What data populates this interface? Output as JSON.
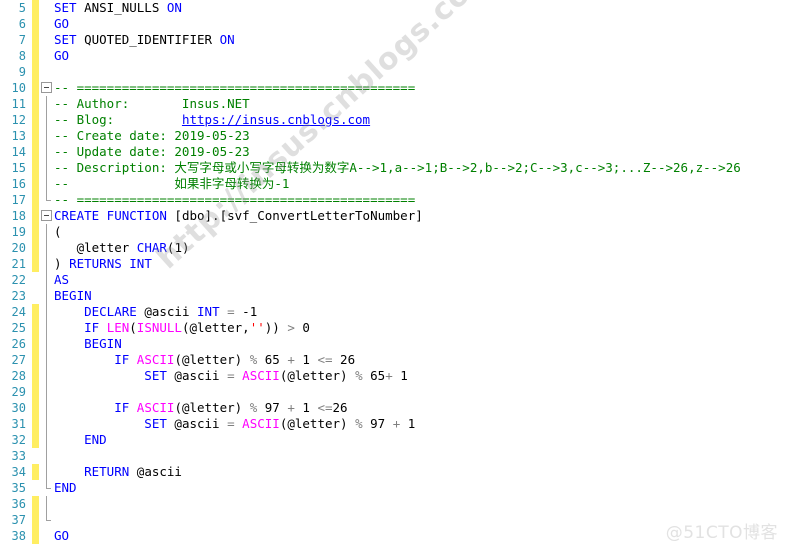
{
  "editor": {
    "language": "sql",
    "theme": "ssms-light",
    "first_visible_line": 5,
    "last_visible_line": 38,
    "colors": {
      "keyword": "#0000ff",
      "function": "#ff00ff",
      "comment": "#008000",
      "string": "#ff0000",
      "operator": "#808080",
      "line_number": "#2b91af",
      "change_bar_modified": "#ffee62",
      "background": "#ffffff"
    }
  },
  "watermarks": {
    "diagonal": "http://insus.cnblogs.com",
    "corner": "@51CTO博客"
  },
  "lines": [
    {
      "n": 5,
      "changed": true,
      "fold": "none",
      "text": "SET ANSI_NULLS ON"
    },
    {
      "n": 6,
      "changed": true,
      "fold": "none",
      "text": "GO"
    },
    {
      "n": 7,
      "changed": true,
      "fold": "none",
      "text": "SET QUOTED_IDENTIFIER ON"
    },
    {
      "n": 8,
      "changed": true,
      "fold": "none",
      "text": "GO"
    },
    {
      "n": 9,
      "changed": true,
      "fold": "none",
      "text": ""
    },
    {
      "n": 10,
      "changed": true,
      "fold": "box",
      "text": "-- ============================================="
    },
    {
      "n": 11,
      "changed": true,
      "fold": "line",
      "text": "-- Author:       Insus.NET"
    },
    {
      "n": 12,
      "changed": true,
      "fold": "line",
      "text": "-- Blog:         https://insus.cnblogs.com"
    },
    {
      "n": 13,
      "changed": true,
      "fold": "line",
      "text": "-- Create date: 2019-05-23"
    },
    {
      "n": 14,
      "changed": true,
      "fold": "line",
      "text": "-- Update date: 2019-05-23"
    },
    {
      "n": 15,
      "changed": true,
      "fold": "line",
      "text": "-- Description: 大写字母或小写字母转换为数字A-->1,a-->1;B-->2,b-->2;C-->3,c-->3;...Z-->26,z-->26"
    },
    {
      "n": 16,
      "changed": true,
      "fold": "line",
      "text": "--              如果非字母转换为-1"
    },
    {
      "n": 17,
      "changed": true,
      "fold": "lineend",
      "text": "-- ============================================="
    },
    {
      "n": 18,
      "changed": true,
      "fold": "box",
      "text": "CREATE FUNCTION [dbo].[svf_ConvertLetterToNumber]"
    },
    {
      "n": 19,
      "changed": true,
      "fold": "line",
      "text": "("
    },
    {
      "n": 20,
      "changed": true,
      "fold": "line",
      "text": "   @letter CHAR(1)"
    },
    {
      "n": 21,
      "changed": true,
      "fold": "line",
      "text": ") RETURNS INT"
    },
    {
      "n": 22,
      "changed": false,
      "fold": "line",
      "text": "AS"
    },
    {
      "n": 23,
      "changed": false,
      "fold": "line",
      "text": "BEGIN"
    },
    {
      "n": 24,
      "changed": true,
      "fold": "line",
      "text": "    DECLARE @ascii INT = -1"
    },
    {
      "n": 25,
      "changed": true,
      "fold": "line",
      "text": "    IF LEN(ISNULL(@letter,'')) > 0"
    },
    {
      "n": 26,
      "changed": true,
      "fold": "line",
      "text": "    BEGIN"
    },
    {
      "n": 27,
      "changed": true,
      "fold": "line",
      "text": "        IF ASCII(@letter) % 65 + 1 <= 26"
    },
    {
      "n": 28,
      "changed": true,
      "fold": "line",
      "text": "            SET @ascii = ASCII(@letter) % 65+ 1"
    },
    {
      "n": 29,
      "changed": true,
      "fold": "line",
      "text": ""
    },
    {
      "n": 30,
      "changed": true,
      "fold": "line",
      "text": "        IF ASCII(@letter) % 97 + 1 <=26"
    },
    {
      "n": 31,
      "changed": true,
      "fold": "line",
      "text": "            SET @ascii = ASCII(@letter) % 97 + 1"
    },
    {
      "n": 32,
      "changed": true,
      "fold": "line",
      "text": "    END"
    },
    {
      "n": 33,
      "changed": false,
      "fold": "line",
      "text": ""
    },
    {
      "n": 34,
      "changed": true,
      "fold": "line",
      "text": "    RETURN @ascii"
    },
    {
      "n": 35,
      "changed": false,
      "fold": "lineend",
      "text": "END"
    },
    {
      "n": 36,
      "changed": true,
      "fold": "line2",
      "text": ""
    },
    {
      "n": 37,
      "changed": true,
      "fold": "line2end",
      "text": ""
    },
    {
      "n": 38,
      "changed": true,
      "fold": "none",
      "text": "GO"
    }
  ],
  "tokens": {
    "line5": [
      [
        "kw",
        "SET"
      ],
      [
        "id",
        " ANSI_NULLS "
      ],
      [
        "kw",
        "ON"
      ]
    ],
    "line6": [
      [
        "kw",
        "GO"
      ]
    ],
    "line7": [
      [
        "kw",
        "SET"
      ],
      [
        "id",
        " QUOTED_IDENTIFIER "
      ],
      [
        "kw",
        "ON"
      ]
    ],
    "line8": [
      [
        "kw",
        "GO"
      ]
    ],
    "line18": [
      [
        "kw",
        "CREATE FUNCTION"
      ],
      [
        "id",
        " [dbo].[svf_ConvertLetterToNumber]"
      ]
    ],
    "line20": [
      [
        "id",
        "   @letter "
      ],
      [
        "kw",
        "CHAR"
      ],
      [
        "id",
        "("
      ],
      [
        "num",
        "1"
      ],
      [
        "id",
        ")"
      ]
    ],
    "line21": [
      [
        "id",
        ") "
      ],
      [
        "kw",
        "RETURNS INT"
      ]
    ],
    "line22": [
      [
        "kw",
        "AS"
      ]
    ],
    "line23": [
      [
        "kw",
        "BEGIN"
      ]
    ],
    "line24": [
      [
        "kw",
        "    DECLARE"
      ],
      [
        "id",
        " @ascii "
      ],
      [
        "kw",
        "INT"
      ],
      [
        "op",
        " = "
      ],
      [
        "num",
        "-1"
      ]
    ],
    "line25": [
      [
        "kw",
        "    IF "
      ],
      [
        "fn",
        "LEN"
      ],
      [
        "id",
        "("
      ],
      [
        "fn",
        "ISNULL"
      ],
      [
        "id",
        "(@letter,"
      ],
      [
        "str",
        "''"
      ],
      [
        "id",
        "))"
      ],
      [
        "op",
        " > "
      ],
      [
        "num",
        "0"
      ]
    ],
    "line26": [
      [
        "kw",
        "    BEGIN"
      ]
    ],
    "line27": [
      [
        "kw",
        "        IF "
      ],
      [
        "fn",
        "ASCII"
      ],
      [
        "id",
        "(@letter) "
      ],
      [
        "op",
        "% "
      ],
      [
        "num",
        "65"
      ],
      [
        "op",
        " + "
      ],
      [
        "num",
        "1"
      ],
      [
        "op",
        " <= "
      ],
      [
        "num",
        "26"
      ]
    ],
    "line28": [
      [
        "kw",
        "            SET"
      ],
      [
        "id",
        " @ascii "
      ],
      [
        "op",
        "= "
      ],
      [
        "fn",
        "ASCII"
      ],
      [
        "id",
        "(@letter) "
      ],
      [
        "op",
        "% "
      ],
      [
        "num",
        "65"
      ],
      [
        "op",
        "+ "
      ],
      [
        "num",
        "1"
      ]
    ],
    "line30": [
      [
        "kw",
        "        IF "
      ],
      [
        "fn",
        "ASCII"
      ],
      [
        "id",
        "(@letter) "
      ],
      [
        "op",
        "% "
      ],
      [
        "num",
        "97"
      ],
      [
        "op",
        " + "
      ],
      [
        "num",
        "1"
      ],
      [
        "op",
        " <="
      ],
      [
        "num",
        "26"
      ]
    ],
    "line31": [
      [
        "kw",
        "            SET"
      ],
      [
        "id",
        " @ascii "
      ],
      [
        "op",
        "= "
      ],
      [
        "fn",
        "ASCII"
      ],
      [
        "id",
        "(@letter) "
      ],
      [
        "op",
        "% "
      ],
      [
        "num",
        "97"
      ],
      [
        "op",
        " + "
      ],
      [
        "num",
        "1"
      ]
    ],
    "line32": [
      [
        "kw",
        "    END"
      ]
    ],
    "line34": [
      [
        "kw",
        "    RETURN"
      ],
      [
        "id",
        " @ascii"
      ]
    ],
    "line35": [
      [
        "kw",
        "END"
      ]
    ],
    "line38": [
      [
        "kw",
        "GO"
      ]
    ]
  }
}
